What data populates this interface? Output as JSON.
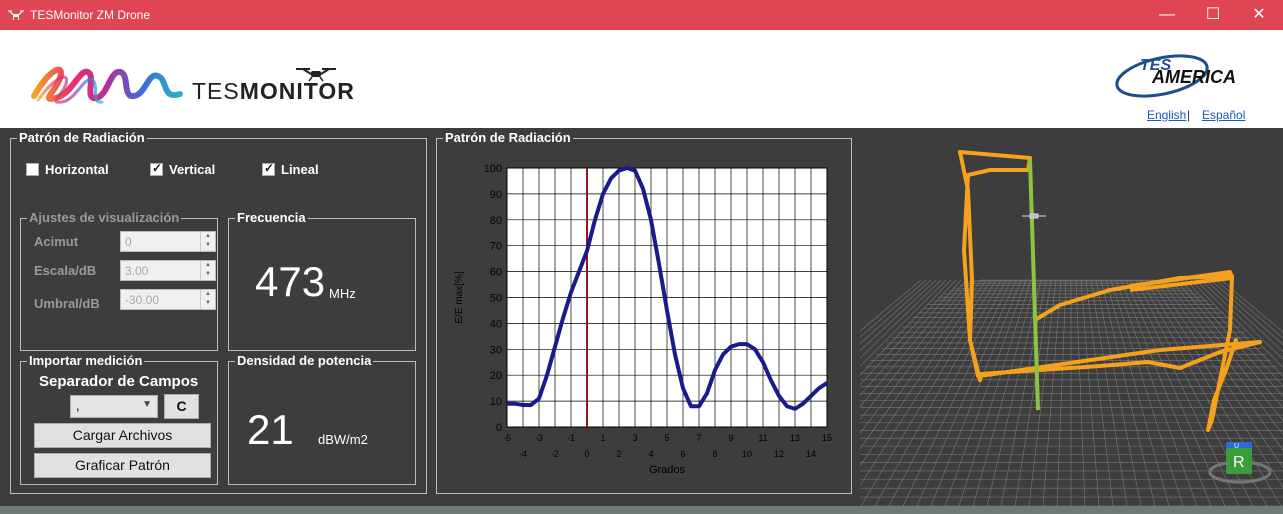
{
  "window": {
    "title": "TESMonitor ZM Drone",
    "minimize": "—",
    "maximize": "☐",
    "close": "✕"
  },
  "header": {
    "brand_tes": "TES",
    "brand_monitor": "MONITOR",
    "partner_line1": "TES",
    "partner_line2": "AMERICA",
    "lang_english": "English",
    "lang_sep": "|",
    "lang_spanish": "Español"
  },
  "left_panel": {
    "title": "Patrón de Radiación",
    "checkboxes": [
      {
        "label": "Horizontal",
        "checked": false
      },
      {
        "label": "Vertical",
        "checked": true
      },
      {
        "label": "Lineal",
        "checked": true
      }
    ],
    "display_settings": {
      "title": "Ajustes de visualización",
      "azimuth_label": "Acimut",
      "azimuth_value": "0",
      "scale_label": "Escala/dB",
      "scale_value": "3.00",
      "threshold_label": "Umbral/dB",
      "threshold_value": "-30.00"
    },
    "frequency": {
      "title": "Frecuencia",
      "value": "473",
      "unit": "MHz"
    },
    "import": {
      "title": "Importar medición",
      "separator_label": "Separador de Campos",
      "separator_value": ",",
      "c_button": "C",
      "load_button": "Cargar Archivos",
      "plot_button": "Graficar Patrón"
    },
    "power_density": {
      "title": "Densidad de potencia",
      "value": "21",
      "unit": "dBW/m2"
    }
  },
  "chart_panel": {
    "title": "Patrón de Radiación"
  },
  "chart_data": {
    "type": "line",
    "title": "",
    "xlabel": "Grados",
    "ylabel": "E/E max[%]",
    "xlim": [
      -5,
      15
    ],
    "ylim": [
      0,
      100
    ],
    "yticks": [
      0,
      10,
      20,
      30,
      40,
      50,
      60,
      70,
      80,
      90,
      100
    ],
    "xticks_top": [
      -5,
      -3,
      -1,
      1,
      3,
      5,
      7,
      9,
      11,
      13,
      15
    ],
    "xticks_bottom": [
      -4,
      -2,
      0,
      2,
      4,
      6,
      8,
      10,
      12,
      14
    ],
    "grid": true,
    "reference_line_x": 0,
    "line_color": "#1a1a8c",
    "reference_color": "#8b1a1a",
    "series": [
      {
        "x": [
          -5,
          -4.5,
          -4,
          -3.5,
          -3,
          -2.5,
          -2,
          -1.5,
          -1,
          -0.5,
          0,
          0.5,
          1,
          1.5,
          2,
          2.5,
          3,
          3.5,
          4,
          4.5,
          5,
          5.5,
          6,
          6.5,
          7,
          7.5,
          8,
          8.5,
          9,
          9.5,
          10,
          10.5,
          11,
          11.5,
          12,
          12.5,
          13,
          13.5,
          14,
          14.5,
          15
        ],
        "values": [
          9,
          9,
          8.5,
          8.5,
          11,
          20,
          31,
          42,
          52,
          60,
          68,
          80,
          90,
          96,
          99,
          100,
          99,
          92,
          80,
          63,
          45,
          28,
          15,
          8,
          8,
          13,
          22,
          28,
          31,
          32,
          32,
          30,
          25,
          18,
          12,
          8,
          7,
          9,
          12,
          15,
          17
        ]
      }
    ]
  },
  "viewport3d": {
    "axis_cube_top": "U",
    "axis_cube_front": "R"
  }
}
